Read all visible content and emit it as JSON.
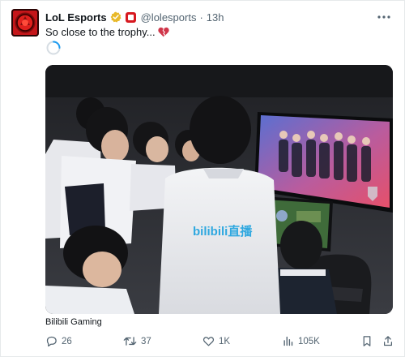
{
  "tweet": {
    "display_name": "LoL Esports",
    "handle": "@lolesports",
    "separator": "·",
    "time": "13h",
    "text": "So close to the trophy...",
    "more_icon": "more-icon",
    "media_caption": "Bilibili Gaming",
    "shirt_text": "bilibili直播"
  },
  "actions": {
    "replies": "26",
    "retweets": "37",
    "likes": "1K",
    "views": "105K"
  },
  "colors": {
    "text": "#0f1419",
    "muted": "#536471",
    "verified_gold": "#e8b92a",
    "affiliate_red": "#d71920",
    "broken_heart": "#d0364a",
    "shirt_text_blue": "#2fa8e0"
  }
}
